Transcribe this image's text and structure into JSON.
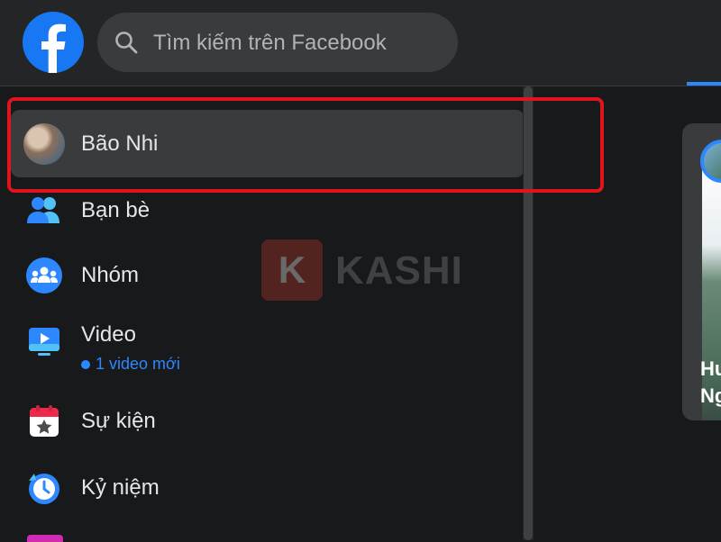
{
  "header": {
    "search_placeholder": "Tìm kiếm trên Facebook"
  },
  "sidebar": {
    "profile": {
      "name": "Bão Nhi"
    },
    "items": [
      {
        "label": "Bạn bè",
        "icon": "friends-icon"
      },
      {
        "label": "Nhóm",
        "icon": "groups-icon"
      },
      {
        "label": "Video",
        "icon": "video-icon",
        "sublabel": "1 video mới"
      },
      {
        "label": "Sự kiện",
        "icon": "events-icon"
      },
      {
        "label": "Kỷ niệm",
        "icon": "memories-icon"
      }
    ]
  },
  "watermark": {
    "letter": "K",
    "text": "KASHI"
  },
  "story": {
    "title_line1": "Hu",
    "title_line2": "Ng"
  },
  "colors": {
    "background": "#18191a",
    "topbar": "#242526",
    "accent": "#2d88ff",
    "highlight": "#e0141e"
  }
}
